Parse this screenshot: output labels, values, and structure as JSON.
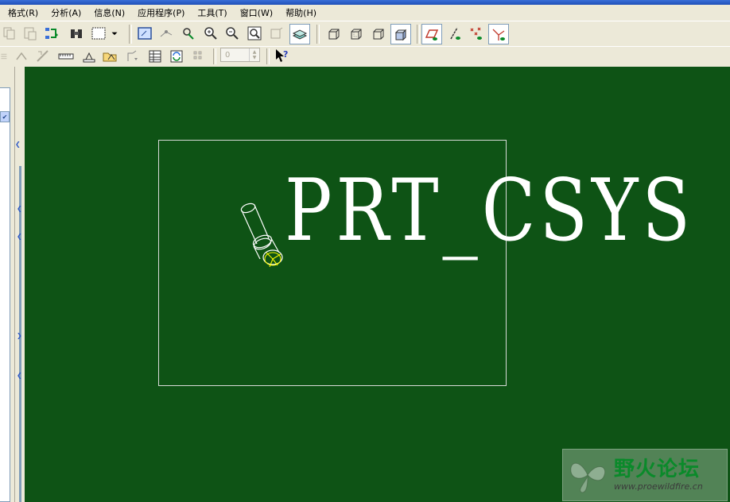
{
  "menu": [
    "格式(R)",
    "分析(A)",
    "信息(N)",
    "应用程序(P)",
    "工具(T)",
    "窗口(W)",
    "帮助(H)"
  ],
  "toolbar": {
    "spin_value": "0"
  },
  "viewport": {
    "csys_label": "PRT_CSYS"
  },
  "watermark": {
    "title": "野火论坛",
    "url": "www.proewildfire.cn"
  },
  "colors": {
    "viewport_background": "#0e5315",
    "model_lines": "#ffffff",
    "csys_axes": "#f5f500",
    "toolbar_background": "#ece9d8"
  }
}
